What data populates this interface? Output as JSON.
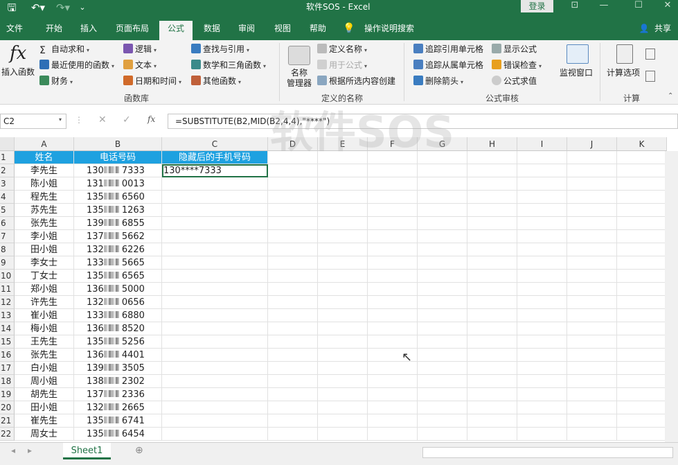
{
  "window": {
    "title": "软件SOS - Excel",
    "login": "登录",
    "share": "共享"
  },
  "tabs": [
    {
      "label": "文件"
    },
    {
      "label": "开始"
    },
    {
      "label": "插入"
    },
    {
      "label": "页面布局"
    },
    {
      "label": "公式",
      "active": true
    },
    {
      "label": "数据"
    },
    {
      "label": "审阅"
    },
    {
      "label": "视图"
    },
    {
      "label": "帮助"
    },
    {
      "label": "操作说明搜索"
    }
  ],
  "ribbon": {
    "insert_function": "插入函数",
    "autosum": "自动求和",
    "recent": "最近使用的函数",
    "financial": "财务",
    "logical": "逻辑",
    "text": "文本",
    "datetime": "日期和时间",
    "lookup": "查找与引用",
    "math": "数学和三角函数",
    "other": "其他函数",
    "group_library": "函数库",
    "name_manager_1": "名称",
    "name_manager_2": "管理器",
    "define_name": "定义名称",
    "use_in_formula": "用于公式",
    "create_from_sel": "根据所选内容创建",
    "group_names": "定义的名称",
    "trace_precedents": "追踪引用单元格",
    "trace_dependents": "追踪从属单元格",
    "remove_arrows": "删除箭头",
    "show_formulas": "显示公式",
    "error_check": "错误检查",
    "eval_formula": "公式求值",
    "watch_window": "监视窗口",
    "group_audit": "公式审核",
    "calc_options": "计算选项",
    "group_calc": "计算"
  },
  "formula_bar": {
    "name_box": "C2",
    "formula": "=SUBSTITUTE(B2,MID(B2,4,4),\"****\")",
    "fx": "fx"
  },
  "columns": [
    "A",
    "B",
    "C",
    "D",
    "E",
    "F",
    "G",
    "H",
    "I",
    "J",
    "K"
  ],
  "header_row": {
    "a": "姓名",
    "b": "电话号码",
    "c": "隐藏后的手机号码"
  },
  "rows": [
    {
      "n": "2",
      "name": "李先生",
      "pre": "130",
      "suf": "7333",
      "hidden": "130****7333"
    },
    {
      "n": "3",
      "name": "陈小姐",
      "pre": "131",
      "suf": "0013",
      "hidden": ""
    },
    {
      "n": "4",
      "name": "程先生",
      "pre": "135",
      "suf": "6560",
      "hidden": ""
    },
    {
      "n": "5",
      "name": "苏先生",
      "pre": "135",
      "suf": "1263",
      "hidden": ""
    },
    {
      "n": "6",
      "name": "张先生",
      "pre": "139",
      "suf": "6855",
      "hidden": ""
    },
    {
      "n": "7",
      "name": "李小姐",
      "pre": "137",
      "suf": "5662",
      "hidden": ""
    },
    {
      "n": "8",
      "name": "田小姐",
      "pre": "132",
      "suf": "6226",
      "hidden": ""
    },
    {
      "n": "9",
      "name": "李女士",
      "pre": "133",
      "suf": "5665",
      "hidden": ""
    },
    {
      "n": "10",
      "name": "丁女士",
      "pre": "135",
      "suf": "6565",
      "hidden": ""
    },
    {
      "n": "11",
      "name": "郑小姐",
      "pre": "136",
      "suf": "5000",
      "hidden": ""
    },
    {
      "n": "12",
      "name": "许先生",
      "pre": "132",
      "suf": "0656",
      "hidden": ""
    },
    {
      "n": "13",
      "name": "崔小姐",
      "pre": "133",
      "suf": "6880",
      "hidden": ""
    },
    {
      "n": "14",
      "name": "梅小姐",
      "pre": "136",
      "suf": "8520",
      "hidden": ""
    },
    {
      "n": "15",
      "name": "王先生",
      "pre": "135",
      "suf": "5256",
      "hidden": ""
    },
    {
      "n": "16",
      "name": "张先生",
      "pre": "136",
      "suf": "4401",
      "hidden": ""
    },
    {
      "n": "17",
      "name": "白小姐",
      "pre": "139",
      "suf": "3505",
      "hidden": ""
    },
    {
      "n": "18",
      "name": "周小姐",
      "pre": "138",
      "suf": "2302",
      "hidden": ""
    },
    {
      "n": "19",
      "name": "胡先生",
      "pre": "137",
      "suf": "2336",
      "hidden": ""
    },
    {
      "n": "20",
      "name": "田小姐",
      "pre": "132",
      "suf": "2665",
      "hidden": ""
    },
    {
      "n": "21",
      "name": "崔先生",
      "pre": "135",
      "suf": "6741",
      "hidden": ""
    },
    {
      "n": "22",
      "name": "周女士",
      "pre": "135",
      "suf": "6454",
      "hidden": ""
    }
  ],
  "sheet_tab": "Sheet1",
  "watermark": "软件SOS",
  "colors": {
    "accent": "#217346",
    "header_fill": "#1ea1e0"
  }
}
